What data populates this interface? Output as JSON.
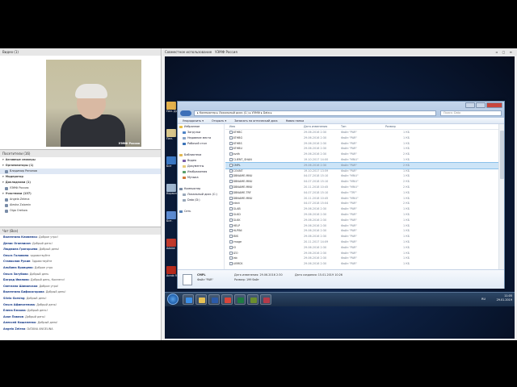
{
  "video": {
    "title": "Видео (1)",
    "logo": "УЭМФ Россия"
  },
  "share": {
    "title": "Совместное использование",
    "subtitle": "УЭМФ Россия"
  },
  "attendees": {
    "title": "Посетители (16)",
    "rows": [
      {
        "label": "Активные спикеры",
        "group": true
      },
      {
        "label": "Организаторы (1)",
        "group": true
      },
      {
        "label": "Владимир Репинов",
        "group": false
      },
      {
        "label": "Модератор",
        "group": true
      },
      {
        "label": "Докладчики (1)",
        "group": true
      },
      {
        "label": "УЭМФ Россия",
        "group": false
      },
      {
        "label": "Участники (137)",
        "group": true
      },
      {
        "label": "Angela Zelena",
        "group": false
      },
      {
        "label": "Alesha Zalomin",
        "group": false
      },
      {
        "label": "Olga Orehow",
        "group": false
      }
    ]
  },
  "chat": {
    "title": "Чат (Все)",
    "messages": [
      {
        "name": "Валентина Клименко",
        "text": ": Доброе утро!"
      },
      {
        "name": "Денис Оганнисян",
        "text": ": Добрый день!"
      },
      {
        "name": "Людмила Григорьева",
        "text": ": Добрый день!"
      },
      {
        "name": "Ольга Головина",
        "text": ": здравствуйте"
      },
      {
        "name": "Станислав Рукин",
        "text": ": Здравствуйте"
      },
      {
        "name": "Альбина Яровцева",
        "text": ": Доброе утро"
      },
      {
        "name": "Ольга Загубова",
        "text": ": Добрый день"
      },
      {
        "name": "Багрод Иванова",
        "text": ": Добрый день, Коллеги!"
      },
      {
        "name": "Светлана Шиманская",
        "text": ": Доброе утро!"
      },
      {
        "name": "Валентина Бифисогорова",
        "text": ": Добрый день!"
      },
      {
        "name": "Silvia Gorsing",
        "text": ": Добрый день!"
      },
      {
        "name": "Ольга Афиногенова",
        "text": ": Добрый день!"
      },
      {
        "name": "Елена Ежкова",
        "text": ": Добрый день!"
      },
      {
        "name": "Ахан Павлов",
        "text": ": Добрый день!"
      },
      {
        "name": "Алексей Кишеленко",
        "text": ": Добрый день!"
      },
      {
        "name": "Angela Zelena",
        "text": ": DATANA ANGELINA"
      }
    ]
  },
  "desktop_icons": [
    {
      "label": "Пан. Докумен.",
      "color": "#e3b04b"
    },
    {
      "label": "Пан.",
      "color": "#d7c58a"
    },
    {
      "label": "Бит",
      "color": "#3b78c4"
    },
    {
      "label": "Корзина",
      "color": "#9fb6cf"
    },
    {
      "label": "Бит.",
      "color": "#5b8ad1"
    },
    {
      "label": "Adobe",
      "color": "#c0392b"
    },
    {
      "label": "Acrob Reader",
      "color": "#b52a1c"
    }
  ],
  "explorer": {
    "address": "▸ Компьютер ▸ Локальный диск (C:) ▸ УЭМФ ▸ Data ▸",
    "search_placeholder": "Поиск: Data",
    "commands": [
      "Упорядочить ▾",
      "Открыть ▾",
      "Записать на оптический диск",
      "Новая папка"
    ],
    "nav": [
      {
        "label": "Избранное",
        "group": true,
        "color": "#e9c046"
      },
      {
        "label": "Загрузки",
        "group": false,
        "color": "#4f85c7"
      },
      {
        "label": "Недавние места",
        "group": false,
        "color": "#8aa4c6"
      },
      {
        "label": "Рабочий стол",
        "group": false,
        "color": "#3a72b8"
      },
      {
        "label": "",
        "group": false,
        "color": "transparent"
      },
      {
        "label": "Библиотеки",
        "group": true,
        "color": "#e2b955"
      },
      {
        "label": "Видео",
        "group": false,
        "color": "#7a5fa8"
      },
      {
        "label": "Документы",
        "group": false,
        "color": "#e7cb7a"
      },
      {
        "label": "Изображения",
        "group": false,
        "color": "#5aa06c"
      },
      {
        "label": "Музыка",
        "group": false,
        "color": "#d27a3c"
      },
      {
        "label": "",
        "group": false,
        "color": "transparent"
      },
      {
        "label": "Компьютер",
        "group": true,
        "color": "#7c8ea6"
      },
      {
        "label": "Локальный диск (C:)",
        "group": false,
        "color": "#9aa8ba"
      },
      {
        "label": "Data (D:)",
        "group": false,
        "color": "#9aa8ba"
      },
      {
        "label": "",
        "group": false,
        "color": "transparent"
      },
      {
        "label": "Сеть",
        "group": true,
        "color": "#5a84b8"
      }
    ],
    "columns": [
      "Имя",
      "Дата изменения",
      "Тип",
      "Размер"
    ],
    "files": [
      {
        "name": "ATHBC",
        "date": "29.06.2016 2:30",
        "type": "Файл \"PAR\"",
        "size": "1 КБ"
      },
      {
        "name": "ATHBG",
        "date": "29.06.2016 2:30",
        "type": "Файл \"PAR\"",
        "size": "1 КБ"
      },
      {
        "name": "ATHBS",
        "date": "29.06.2016 2:30",
        "type": "Файл \"PAR\"",
        "size": "1 КБ"
      },
      {
        "name": "ATHBU",
        "date": "29.06.2016 2:30",
        "type": "Файл \"PAR\"",
        "size": "1 КБ"
      },
      {
        "name": "bvdh",
        "date": "29.06.2016 2:30",
        "type": "Файл \"PAR\"",
        "size": "2 КБ"
      },
      {
        "name": "CLIENT_SHAN",
        "date": "19.10.2017 14:00",
        "type": "Файл \"MNU\"",
        "size": "1 КБ"
      },
      {
        "name": "CMPL",
        "date": "29.06.2016 2:30",
        "type": "Файл \"PAR\"",
        "size": "2 КБ",
        "selected": true
      },
      {
        "name": "COUNT",
        "date": "19.10.2017 13:59",
        "type": "Файл \"PAR\"",
        "size": "1 КБ"
      },
      {
        "name": "DBNAME.MNU",
        "date": "04.07.2018 15:10",
        "type": "Файл \"MNU\"",
        "size": "1 КБ"
      },
      {
        "name": "DBNAME.MNU",
        "date": "04.07.2018 15:10",
        "type": "Файл \"MNU\"",
        "size": "2 КБ"
      },
      {
        "name": "DBNAME.MNU",
        "date": "20.11.2018 10:45",
        "type": "Файл \"MNU\"",
        "size": "2 КБ"
      },
      {
        "name": "DBNAME.TRF",
        "date": "04.07.2018 15:10",
        "type": "Файл \"TRF\"",
        "size": "1 КБ"
      },
      {
        "name": "DBNAME.MNU",
        "date": "20.11.2018 10:45",
        "type": "Файл \"MNU\"",
        "size": "1 КБ"
      },
      {
        "name": "elect",
        "date": "04.07.2018 15:04",
        "type": "Файл \"PAR\"",
        "size": "2 КБ"
      },
      {
        "name": "GLAB",
        "date": "29.06.2016 2:30",
        "type": "Файл \"PAR\"",
        "size": "1 КБ"
      },
      {
        "name": "GLKD",
        "date": "29.06.2016 2:30",
        "type": "Файл \"PAR\"",
        "size": "1 КБ"
      },
      {
        "name": "GLKK",
        "date": "29.06.2016 2:30",
        "type": "Файл \"PAR\"",
        "size": "1 КБ"
      },
      {
        "name": "HELP",
        "date": "29.06.2016 2:30",
        "type": "Файл \"PAR\"",
        "size": "1 КБ"
      },
      {
        "name": "HLPINI",
        "date": "29.06.2016 2:30",
        "type": "Файл \"PAR\"",
        "size": "1 КБ"
      },
      {
        "name": "IBIS",
        "date": "29.06.2016 2:30",
        "type": "Файл \"PAR\"",
        "size": "1 КБ"
      },
      {
        "name": "image",
        "date": "20.11.2017 14:09",
        "type": "Файл \"PAR\"",
        "size": "1 КБ"
      },
      {
        "name": "IO",
        "date": "29.06.2016 2:30",
        "type": "Файл \"PAR\"",
        "size": "1 КБ"
      },
      {
        "name": "IZO",
        "date": "29.06.2016 2:30",
        "type": "Файл \"PAR\"",
        "size": "1 КБ"
      },
      {
        "name": "lab",
        "date": "29.06.2016 2:30",
        "type": "Файл \"PAR\"",
        "size": "1 КБ"
      },
      {
        "name": "LIBRCK",
        "date": "29.06.2016 2:30",
        "type": "Файл \"PAR\"",
        "size": "1 КБ"
      }
    ],
    "details": {
      "name": "CMPL",
      "modified": "Дата изменения: 29.06.2016 2:30",
      "type": "Файл \"PAR\"",
      "size": "Размер: 199 байт",
      "created": "Дата создания: 15.01.2019 10:26"
    }
  },
  "taskbar": {
    "apps": [
      {
        "name": "ie",
        "color": "#3a8ee6"
      },
      {
        "name": "explorer",
        "color": "#e6c054"
      },
      {
        "name": "word",
        "color": "#2b5aa8"
      },
      {
        "name": "chrome",
        "color": "#d8453a"
      },
      {
        "name": "excel",
        "color": "#1e7a43"
      },
      {
        "name": "app6",
        "color": "#6b8e2f"
      },
      {
        "name": "app7",
        "color": "#b43b4a"
      }
    ],
    "lang": "RU",
    "time": "11:05",
    "date": "29.01.2019"
  }
}
